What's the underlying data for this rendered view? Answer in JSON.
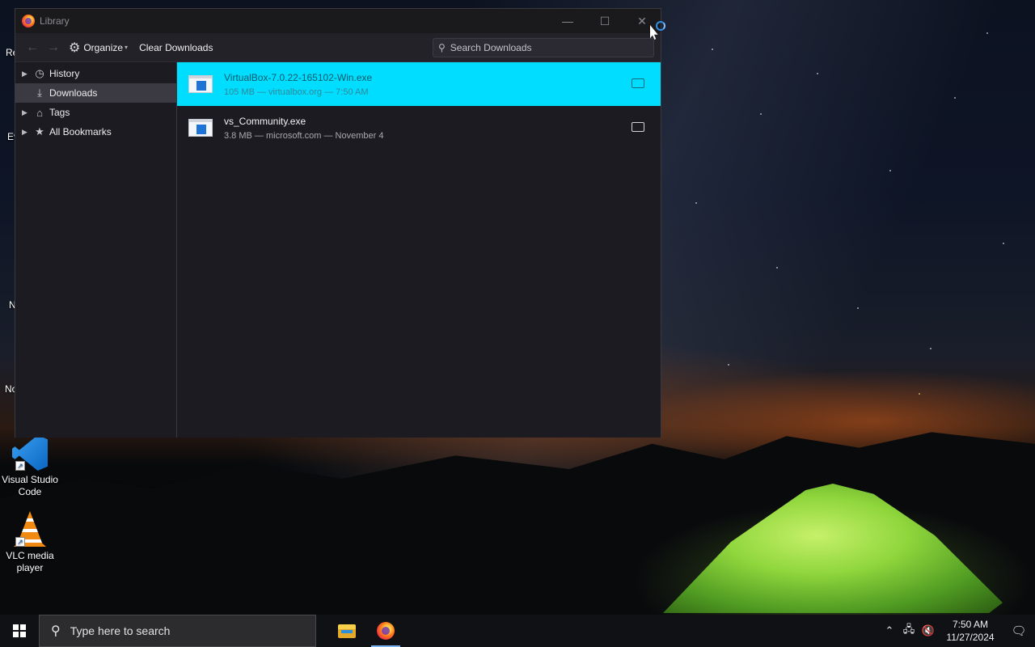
{
  "window": {
    "title": "Library",
    "controls": {
      "minimize": "—",
      "maximize": "☐",
      "close": "✕"
    }
  },
  "toolbar": {
    "back": "←",
    "forward": "→",
    "organize_label": "Organize",
    "organize_caret": "▾",
    "clear_label": "Clear Downloads",
    "search_placeholder": "Search Downloads"
  },
  "sidebar": {
    "items": [
      {
        "label": "History",
        "icon": "clock-icon",
        "expandable": true,
        "selected": false
      },
      {
        "label": "Downloads",
        "icon": "download-icon",
        "expandable": false,
        "selected": true
      },
      {
        "label": "Tags",
        "icon": "tag-icon",
        "expandable": true,
        "selected": false
      },
      {
        "label": "All Bookmarks",
        "icon": "star-icon",
        "expandable": true,
        "selected": false
      }
    ]
  },
  "downloads": [
    {
      "name": "VirtualBox-7.0.22-165102-Win.exe",
      "meta": "105 MB — virtualbox.org — 7:50 AM",
      "selected": true
    },
    {
      "name": "vs_Community.exe",
      "meta": "3.8 MB — microsoft.com — November 4",
      "selected": false
    }
  ],
  "desktop": {
    "icons": [
      {
        "label": "Visual Studio Code",
        "icon": "vscode-icon"
      },
      {
        "label": "VLC media player",
        "icon": "vlc-icon"
      }
    ],
    "partial_labels": [
      "Re",
      "Ev",
      "N",
      "No"
    ]
  },
  "taskbar": {
    "search_placeholder": "Type here to search",
    "time": "7:50 AM",
    "date": "11/27/2024",
    "apps": [
      "file-explorer-icon",
      "firefox-icon"
    ]
  },
  "colors": {
    "accent": "#00ddff",
    "window_bg": "#1c1b22",
    "taskbar_bg": "#101114"
  }
}
